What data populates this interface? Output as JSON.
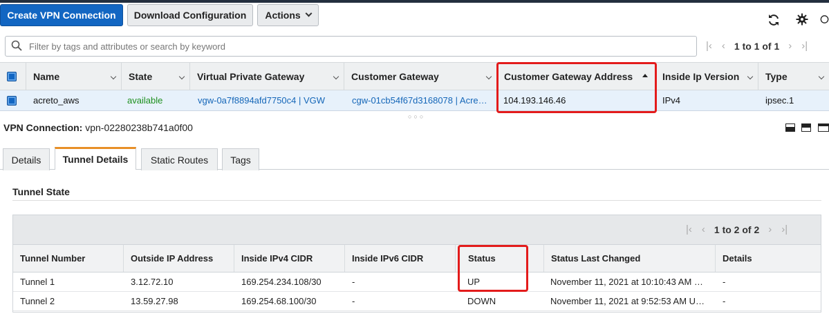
{
  "toolbar": {
    "create_label": "Create VPN Connection",
    "download_label": "Download Configuration",
    "actions_label": "Actions",
    "refresh_icon": "refresh-icon",
    "settings_icon": "gear-icon"
  },
  "search": {
    "placeholder": "Filter by tags and attributes or search by keyword"
  },
  "main_pager": {
    "text": "1 to 1 of 1"
  },
  "main_table": {
    "columns": [
      "Name",
      "State",
      "Virtual Private Gateway",
      "Customer Gateway",
      "Customer Gateway Address",
      "Inside Ip Version",
      "Type"
    ],
    "rows": [
      {
        "name": "acreto_aws",
        "state": "available",
        "vpg": "vgw-0a7f8894afd7750c4 | VGW",
        "cgw": "cgw-01cb54f67d3168078 | Acre…",
        "cgw_address": "104.193.146.46",
        "ip_version": "IPv4",
        "type": "ipsec.1"
      }
    ]
  },
  "detail": {
    "title_label": "VPN Connection:",
    "title_value": "vpn-02280238b741a0f00",
    "tabs": [
      "Details",
      "Tunnel Details",
      "Static Routes",
      "Tags"
    ],
    "active_tab": "Tunnel Details",
    "section_title": "Tunnel State",
    "pager_text": "1 to 2 of 2",
    "columns": [
      "Tunnel Number",
      "Outside IP Address",
      "Inside IPv4 CIDR",
      "Inside IPv6 CIDR",
      "Status",
      "Status Last Changed",
      "Details"
    ],
    "rows": [
      {
        "tunnel": "Tunnel 1",
        "outside_ip": "3.12.72.10",
        "inside_v4": "169.254.234.108/30",
        "inside_v6": "-",
        "status": "UP",
        "changed": "November 11, 2021 at 10:10:43 AM …",
        "details": "-"
      },
      {
        "tunnel": "Tunnel 2",
        "outside_ip": "13.59.27.98",
        "inside_v4": "169.254.68.100/30",
        "inside_v6": "-",
        "status": "DOWN",
        "changed": "November 11, 2021 at 9:52:53 AM U…",
        "details": "-"
      }
    ]
  },
  "colors": {
    "primary": "#1266c2",
    "status_up": "#1d8f1d",
    "status_down": "#c8102e",
    "highlight": "#e31b1b",
    "tab_accent": "#e88f27"
  }
}
